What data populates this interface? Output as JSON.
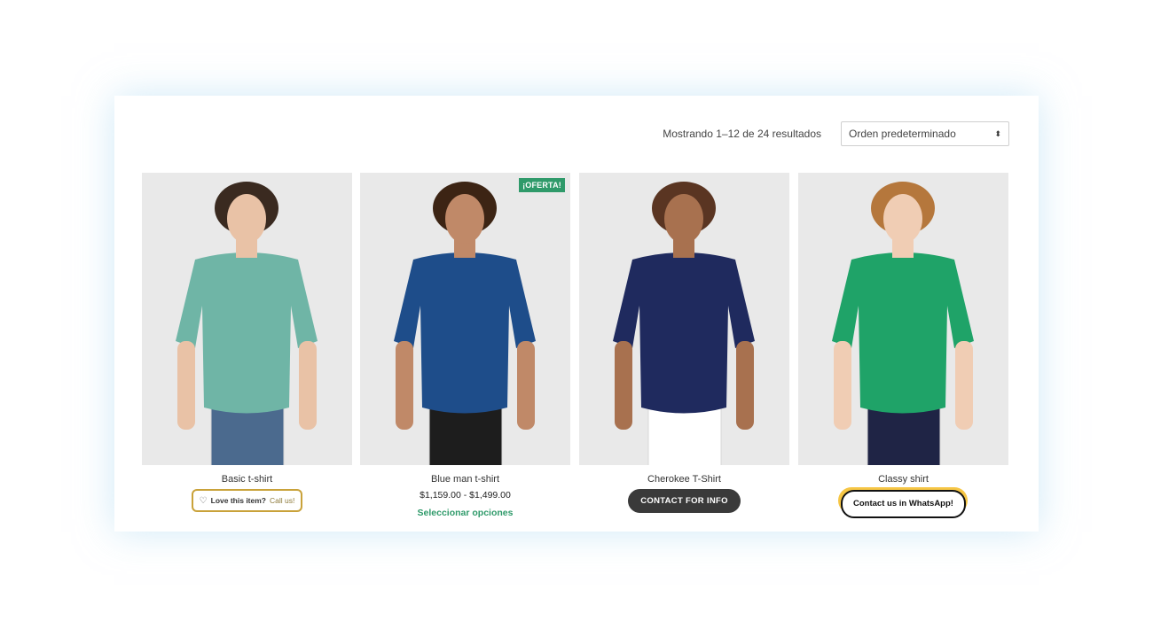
{
  "toolbar": {
    "result_count": "Mostrando 1–12 de 24 resultados",
    "orderby_selected": "Orden predeterminado"
  },
  "products": [
    {
      "title": "Basic t-shirt",
      "button_bold": "Love this item?",
      "button_rest": "Call us!",
      "shirt_color": "#6fb5a6",
      "pants_color": "#4b6a8e",
      "skin_color": "#e9c2a6",
      "hair_color": "#3a2a20"
    },
    {
      "title": "Blue man t-shirt",
      "badge": "¡OFERTA!",
      "price": "$1,159.00 - $1,499.00",
      "link": "Seleccionar opciones",
      "shirt_color": "#1e4d8a",
      "pants_color": "#1d1d1d",
      "skin_color": "#c08968",
      "hair_color": "#3c2414"
    },
    {
      "title": "Cherokee T-Shirt",
      "button": "CONTACT FOR INFO",
      "shirt_color": "#1f2a5e",
      "pants_color": "#ffffff",
      "skin_color": "#a8714f",
      "hair_color": "#5a3522"
    },
    {
      "title": "Classy shirt",
      "button": "Contact us in WhatsApp!",
      "shirt_color": "#1fa368",
      "pants_color": "#1f2445",
      "skin_color": "#f0cdb4",
      "hair_color": "#b5773c"
    }
  ]
}
